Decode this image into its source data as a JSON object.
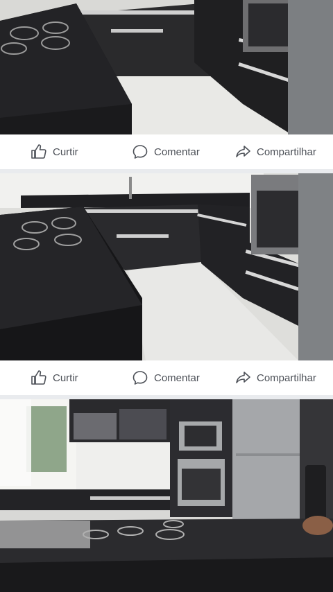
{
  "feed": {
    "posts": [
      {
        "photo": {
          "alt": "cozinha planejada preta com bancada de granito e fogão cooktop"
        },
        "actions": {
          "like": "Curtir",
          "comment": "Comentar",
          "share": "Compartilhar"
        }
      },
      {
        "photo": {
          "alt": "cozinha em U com forno embutido e piso branco"
        },
        "actions": {
          "like": "Curtir",
          "comment": "Comentar",
          "share": "Compartilhar"
        }
      },
      {
        "photo": {
          "alt": "cozinha com armários de vidro, forno, micro-ondas e geladeira inox"
        }
      }
    ]
  },
  "icons": {
    "like": "thumbs-up-icon",
    "comment": "speech-bubble-icon",
    "share": "share-arrow-icon"
  },
  "colors": {
    "action_text": "#4b4f56",
    "separator": "#e9ebee",
    "card_bg": "#ffffff"
  }
}
